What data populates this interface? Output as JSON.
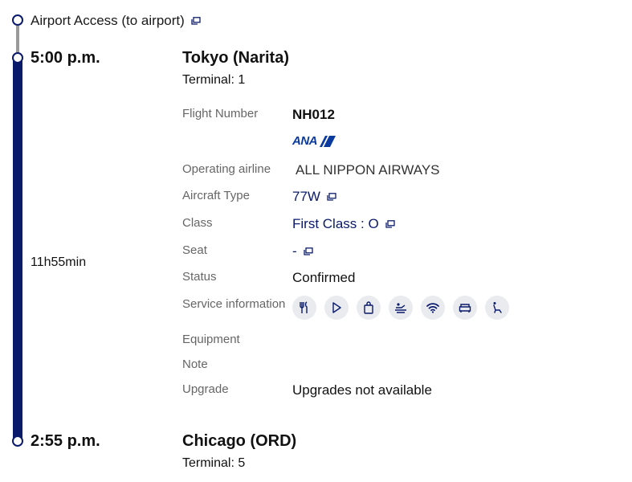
{
  "access": {
    "label": "Airport Access (to airport)"
  },
  "departure": {
    "time": "5:00 p.m.",
    "city": "Tokyo (Narita)",
    "terminal": "Terminal: 1"
  },
  "duration": "11h55min",
  "details": {
    "flight_number": {
      "label": "Flight Number",
      "value": "NH012"
    },
    "airline_logo": {
      "text": "ANA"
    },
    "operating_airline": {
      "label": "Operating airline",
      "value": "ALL NIPPON AIRWAYS"
    },
    "aircraft_type": {
      "label": "Aircraft Type",
      "value": "77W"
    },
    "class": {
      "label": "Class",
      "value": "First Class : O"
    },
    "seat": {
      "label": "Seat",
      "value": "-"
    },
    "status": {
      "label": "Status",
      "value": "Confirmed"
    },
    "service_information": {
      "label": "Service information",
      "icons": [
        "meal-icon",
        "entertainment-play-icon",
        "duty-free-bag-icon",
        "flat-bed-seat-icon",
        "wifi-icon",
        "lounge-sofa-icon",
        "reclining-seat-icon"
      ]
    },
    "equipment": {
      "label": "Equipment",
      "value": ""
    },
    "note": {
      "label": "Note",
      "value": ""
    },
    "upgrade": {
      "label": "Upgrade",
      "value": "Upgrades not available"
    }
  },
  "arrival": {
    "time": "2:55 p.m.",
    "city": "Chicago (ORD)",
    "terminal": "Terminal: 5"
  },
  "colors": {
    "navy": "#0a1a6b",
    "line_gray": "#9a9a9a",
    "icon_bg": "#e9ebef",
    "ana_blue": "#0a3a9e"
  }
}
